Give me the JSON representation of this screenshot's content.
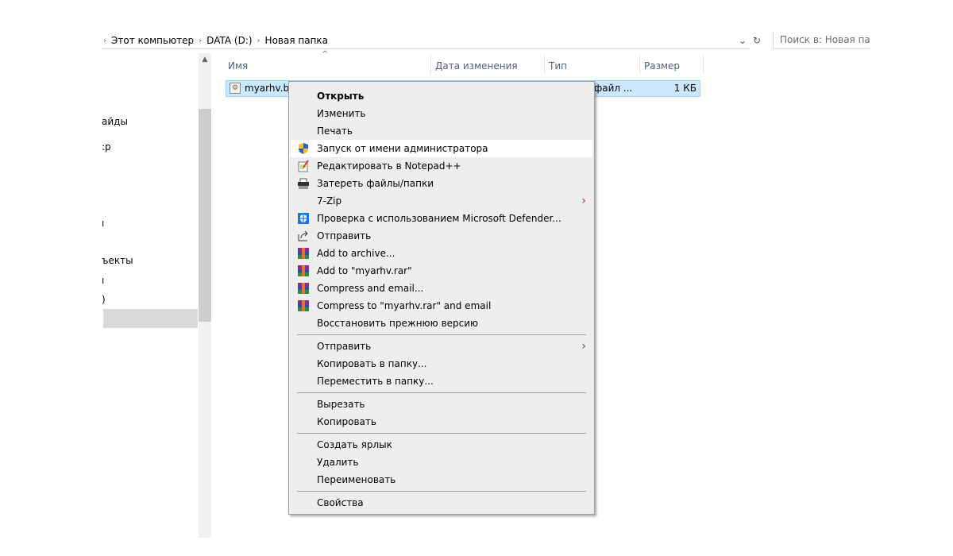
{
  "breadcrumb": [
    "Этот компьютер",
    "DATA (D:)",
    "Новая папка"
  ],
  "search": {
    "placeholder": "Поиск в: Новая папка"
  },
  "nav_fragments": [
    "айды",
    ":р",
    "ı",
    "ъекты",
    "ı",
    ")"
  ],
  "columns": {
    "name": "Имя",
    "date": "Дата изменения",
    "type": "Тип",
    "size": "Размер"
  },
  "file": {
    "name": "myarhv.ba",
    "type": "файл ...",
    "size": "1 КБ"
  },
  "menu": {
    "items": [
      {
        "label": "Открыть",
        "bold": true,
        "icon": ""
      },
      {
        "label": "Изменить",
        "icon": ""
      },
      {
        "label": "Печать",
        "icon": ""
      },
      {
        "label": "Запуск от имени администратора",
        "icon": "uac-shield-icon",
        "highlighted": true
      },
      {
        "label": "Редактировать в Notepad++",
        "icon": "notepad-plus-plus-icon"
      },
      {
        "label": "Затереть файлы/папки",
        "icon": "shredder-icon"
      },
      {
        "label": "7-Zip",
        "icon": "",
        "submenu": true
      },
      {
        "label": "Проверка с использованием Microsoft Defender...",
        "icon": "defender-icon"
      },
      {
        "label": "Отправить",
        "icon": "share-icon"
      },
      {
        "label": "Add to archive...",
        "icon": "winrar-icon"
      },
      {
        "label": "Add to \"myarhv.rar\"",
        "icon": "winrar-icon"
      },
      {
        "label": "Compress and email...",
        "icon": "winrar-icon"
      },
      {
        "label": "Compress to \"myarhv.rar\" and email",
        "icon": "winrar-icon"
      },
      {
        "label": "Восстановить прежнюю версию",
        "icon": ""
      },
      {
        "label": "Отправить",
        "icon": "",
        "submenu": true
      },
      {
        "label": "Копировать в папку...",
        "icon": ""
      },
      {
        "label": "Переместить в папку...",
        "icon": ""
      },
      {
        "label": "Вырезать",
        "icon": ""
      },
      {
        "label": "Копировать",
        "icon": ""
      },
      {
        "label": "Создать ярлык",
        "icon": ""
      },
      {
        "label": "Удалить",
        "icon": ""
      },
      {
        "label": "Переименовать",
        "icon": ""
      },
      {
        "label": "Свойства",
        "icon": ""
      }
    ]
  },
  "colors": {
    "selection": "#cce8ff",
    "selection_border": "#99d1ff",
    "menu_bg": "#eeeeee",
    "header_text": "#4c607a"
  }
}
